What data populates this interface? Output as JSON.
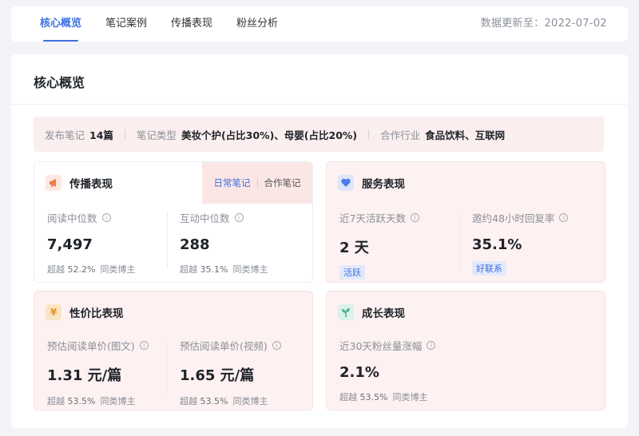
{
  "tabs": [
    {
      "label": "核心概览",
      "active": true
    },
    {
      "label": "笔记案例",
      "active": false
    },
    {
      "label": "传播表现",
      "active": false
    },
    {
      "label": "粉丝分析",
      "active": false
    }
  ],
  "update_time": "数据更新至：2022-07-02",
  "panel_title": "核心概览",
  "info_strip": {
    "published_label": "发布笔记",
    "published_value": "14篇",
    "type_label": "笔记类型",
    "type_value": "美妆个护(占比30%)、母婴(占比20%)",
    "industry_label": "合作行业",
    "industry_value": "食品饮料、互联网"
  },
  "colors": {
    "accent": "#3d6fe0",
    "card_pink": "#fdf1f1",
    "strip_pink": "#fbeeee"
  },
  "cards": {
    "spread": {
      "title": "传播表现",
      "icon": "megaphone-icon",
      "toggle": {
        "daily": "日常笔记",
        "coop": "合作笔记",
        "active": "daily"
      },
      "metrics": [
        {
          "label": "阅读中位数",
          "value": "7,497",
          "sub_prefix": "超越",
          "sub_pct": "52.2%",
          "sub_suffix": "同类博主"
        },
        {
          "label": "互动中位数",
          "value": "288",
          "sub_prefix": "超越",
          "sub_pct": "35.1%",
          "sub_suffix": "同类博主"
        }
      ]
    },
    "service": {
      "title": "服务表现",
      "icon": "heart-handshake-icon",
      "metrics": [
        {
          "label": "近7天活跃天数",
          "value": "2 天",
          "tag": "活跃"
        },
        {
          "label": "邀约48小时回复率",
          "value": "35.1%",
          "tag": "好联系"
        }
      ]
    },
    "value": {
      "title": "性价比表现",
      "icon": "yuan-icon",
      "metrics": [
        {
          "label": "预估阅读单价(图文)",
          "value": "1.31 元/篇",
          "sub_prefix": "超越",
          "sub_pct": "53.5%",
          "sub_suffix": "同类博主"
        },
        {
          "label": "预估阅读单价(视频)",
          "value": "1.65 元/篇",
          "sub_prefix": "超越",
          "sub_pct": "53.5%",
          "sub_suffix": "同类博主"
        }
      ]
    },
    "growth": {
      "title": "成长表现",
      "icon": "sprout-icon",
      "metrics": [
        {
          "label": "近30天粉丝量涨幅",
          "value": "2.1%",
          "sub_prefix": "超越",
          "sub_pct": "53.5%",
          "sub_suffix": "同类博主"
        }
      ]
    }
  }
}
